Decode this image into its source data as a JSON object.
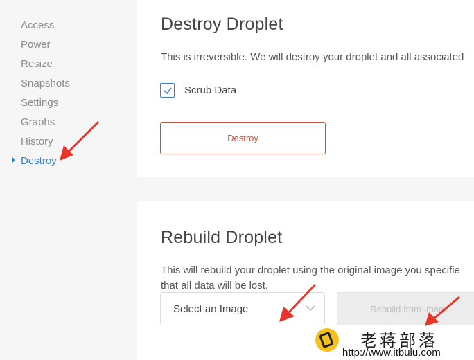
{
  "sidebar": {
    "items": [
      {
        "label": "Access"
      },
      {
        "label": "Power"
      },
      {
        "label": "Resize"
      },
      {
        "label": "Snapshots"
      },
      {
        "label": "Settings"
      },
      {
        "label": "Graphs"
      },
      {
        "label": "History"
      },
      {
        "label": "Destroy"
      }
    ],
    "active_index": 7
  },
  "destroy": {
    "title": "Destroy Droplet",
    "description": "This is irreversible. We will destroy your droplet and all associated",
    "checkbox_label": "Scrub Data",
    "checkbox_checked": true,
    "button_label": "Destroy"
  },
  "rebuild": {
    "title": "Rebuild Droplet",
    "description_line1": "This will rebuild your droplet using the original image you specifie",
    "description_line2": "that all data will be lost.",
    "select_value": "Select an Image",
    "button_label": "Rebuild from Image"
  },
  "watermark": {
    "title": "老蒋部落",
    "url": "http://www.itbulu.com"
  },
  "colors": {
    "accent": "#2f85d4",
    "danger": "#c8513d",
    "annotation_arrow": "#e8352b"
  }
}
